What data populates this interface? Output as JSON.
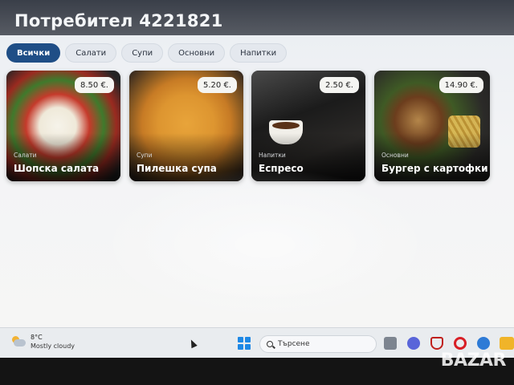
{
  "header": {
    "title": "Потребител 4221821"
  },
  "tabs": [
    {
      "label": "Всички",
      "active": true
    },
    {
      "label": "Салати",
      "active": false
    },
    {
      "label": "Супи",
      "active": false
    },
    {
      "label": "Основни",
      "active": false
    },
    {
      "label": "Напитки",
      "active": false
    }
  ],
  "menu_items": [
    {
      "category": "Салати",
      "name": "Шопска салата",
      "price": "8.50 €."
    },
    {
      "category": "Супи",
      "name": "Пилешка супа",
      "price": "5.20 €."
    },
    {
      "category": "Напитки",
      "name": "Еспресо",
      "price": "2.50 €."
    },
    {
      "category": "Основни",
      "name": "Бургер с картофки",
      "price": "14.90 €."
    }
  ],
  "taskbar": {
    "weather": {
      "temp": "8°C",
      "condition": "Mostly cloudy",
      "icon": "partly-cloudy-icon"
    },
    "search_placeholder": "Търсене",
    "icons": [
      "windows-start-icon",
      "task-view-icon",
      "teams-icon",
      "mcafee-icon",
      "opera-icon",
      "edge-icon",
      "file-explorer-icon"
    ]
  },
  "watermark": {
    "text": "BAZAR"
  },
  "colors": {
    "active_tab": "#1f4e86",
    "background": "#f3f4f6"
  }
}
